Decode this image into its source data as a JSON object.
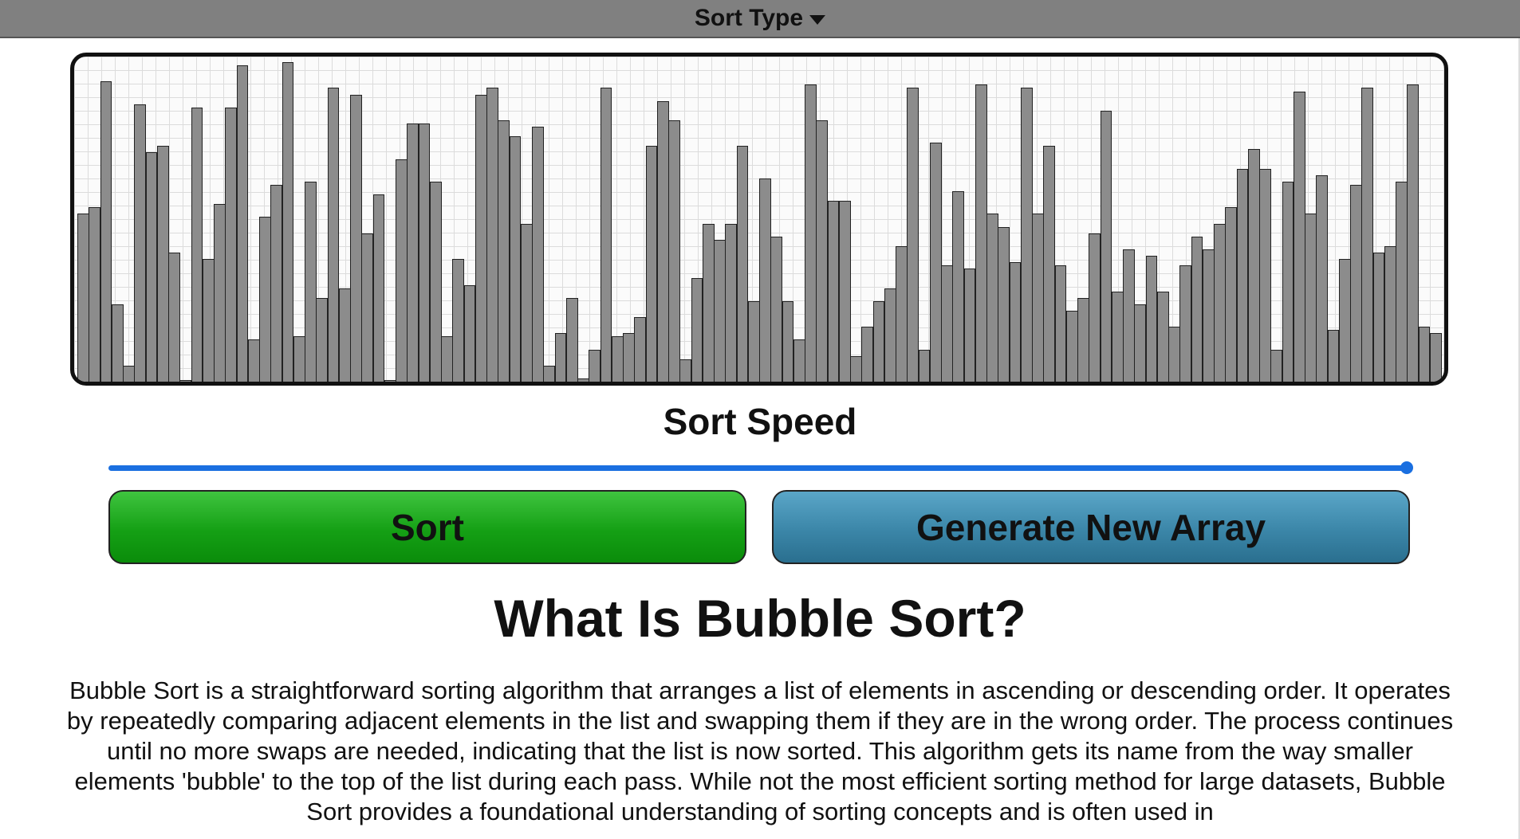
{
  "header": {
    "dropdown_label": "Sort Type",
    "dropdown_icon": "caret-down-icon"
  },
  "visualizer": {
    "max_value": 100,
    "values": [
      52,
      54,
      93,
      24,
      5,
      86,
      71,
      73,
      40,
      0,
      85,
      38,
      55,
      85,
      98,
      13,
      51,
      61,
      99,
      14,
      62,
      26,
      91,
      29,
      89,
      46,
      58,
      0,
      69,
      80,
      80,
      62,
      14,
      38,
      30,
      89,
      91,
      81,
      76,
      49,
      79,
      5,
      15,
      26,
      1,
      10,
      91,
      14,
      15,
      20,
      73,
      87,
      81,
      7,
      32,
      49,
      44,
      49,
      73,
      25,
      63,
      45,
      25,
      13,
      92,
      81,
      56,
      56,
      8,
      17,
      25,
      29,
      42,
      91,
      10,
      74,
      36,
      59,
      35,
      92,
      52,
      48,
      37,
      91,
      52,
      73,
      36,
      22,
      26,
      46,
      84,
      28,
      41,
      24,
      39,
      28,
      17,
      36,
      45,
      41,
      49,
      54,
      66,
      72,
      66,
      10,
      62,
      90,
      52,
      64,
      16,
      38,
      61,
      91,
      40,
      42,
      62,
      92,
      17,
      15
    ]
  },
  "speed": {
    "label": "Sort Speed",
    "value_fraction": 1.0,
    "color": "#1a6fe0"
  },
  "buttons": {
    "sort_label": "Sort",
    "generate_label": "Generate New Array"
  },
  "article": {
    "title": "What Is Bubble Sort?",
    "body": "Bubble Sort is a straightforward sorting algorithm that arranges a list of elements in ascending or descending order. It operates by repeatedly comparing adjacent elements in the list and swapping them if they are in the wrong order. The process continues until no more swaps are needed, indicating that the list is now sorted. This algorithm gets its name from the way smaller elements 'bubble' to the top of the list during each pass. While not the most efficient sorting method for large datasets, Bubble Sort provides a foundational understanding of sorting concepts and is often used in"
  }
}
